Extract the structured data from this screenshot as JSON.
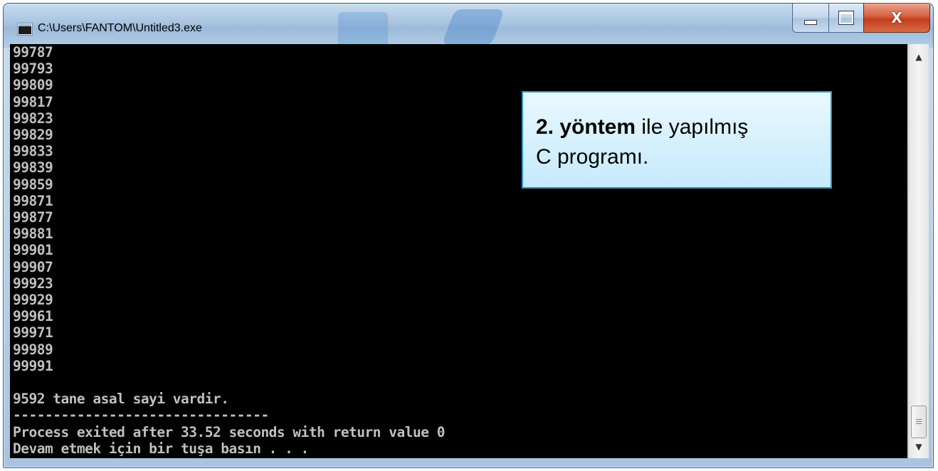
{
  "window": {
    "title": "C:\\Users\\FANTOM\\Untitled3.exe",
    "controls": {
      "minimize_icon": "minimize-icon",
      "maximize_icon": "maximize-icon",
      "close_icon": "close-icon",
      "close_glyph": "X"
    }
  },
  "console": {
    "lines": [
      "99787",
      "99793",
      "99809",
      "99817",
      "99823",
      "99829",
      "99833",
      "99839",
      "99859",
      "99871",
      "99877",
      "99881",
      "99901",
      "99907",
      "99923",
      "99929",
      "99961",
      "99971",
      "99989",
      "99991"
    ],
    "summary": "9592 tane asal sayi vardir.",
    "separator": "--------------------------------",
    "process_line": "Process exited after 33.52 seconds with return value 0",
    "prompt_line": "Devam etmek için bir tuşa basın . . ."
  },
  "callout": {
    "bold": "2. yöntem",
    "rest": " ile yapılmış",
    "line2": "C programı."
  },
  "scrollbar": {
    "up_icon": "scroll-up-icon",
    "down_icon": "scroll-down-icon",
    "up_glyph": "▲",
    "down_glyph": "▼"
  },
  "colors": {
    "console_bg": "#000000",
    "console_text": "#c0c0c0",
    "callout_border": "#2e94c9",
    "close_red": "#c43e1c"
  }
}
